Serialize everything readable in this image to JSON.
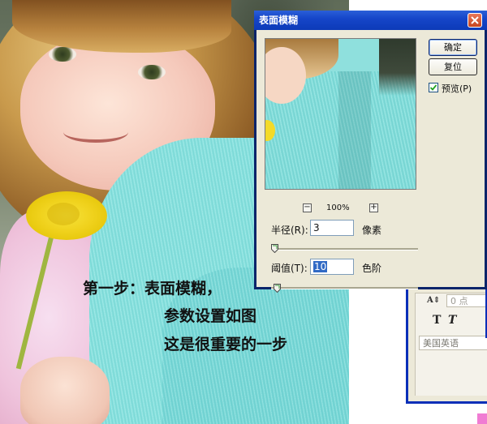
{
  "caption": {
    "line1": "第一步：表面模糊，",
    "line2": "参数设置如图",
    "line3": "这是很重要的一步"
  },
  "dialog": {
    "title": "表面模糊",
    "ok_label": "确定",
    "reset_label": "复位",
    "preview_checked": true,
    "preview_label": "预览(P)",
    "zoom_level": "100%",
    "radius_label": "半径(R):",
    "radius_value": "3",
    "radius_unit": "像素",
    "radius_slider_fraction": 0.02,
    "threshold_label": "阈值(T):",
    "threshold_value": "10",
    "threshold_unit": "色阶",
    "threshold_slider_fraction": 0.04
  },
  "character_panel": {
    "size_placeholder": "0 点",
    "faux_bold": "T",
    "faux_italic": "T",
    "language": "美国英语"
  },
  "icons": {
    "close": "close-icon",
    "zoom_out": "zoom-out-icon",
    "zoom_in": "zoom-in-icon",
    "leading": "leading-icon",
    "checkmark": "checkmark-icon"
  },
  "colors": {
    "titlebar": "#1646c9",
    "dialog_bg": "#ece9d8",
    "close_button": "#c7451f",
    "selection": "#316ac5",
    "sweater": "#8ee3df"
  }
}
